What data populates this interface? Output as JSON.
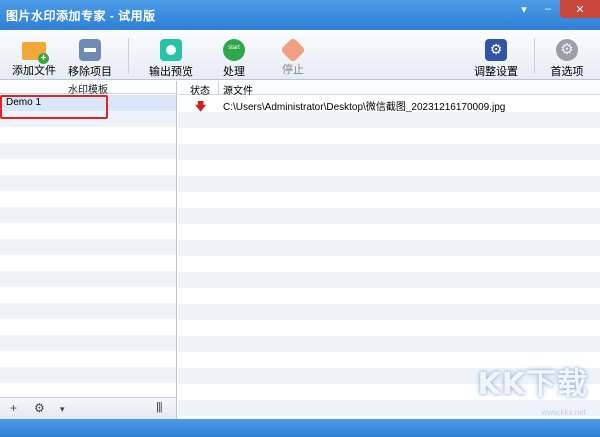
{
  "window": {
    "title": "图片水印添加专家 - 试用版",
    "controls": {
      "minimize": "▾",
      "min2": "–",
      "close": "✕"
    }
  },
  "toolbar": {
    "add_file": "添加文件",
    "remove_item": "移除项目",
    "export_preview": "输出预览",
    "process": "处理",
    "stop": "停止",
    "adjust_settings": "调整设置",
    "preferences": "首选项"
  },
  "left": {
    "header": "水印模板",
    "items": [
      {
        "label": "Demo 1"
      }
    ],
    "footer": {
      "add": "+",
      "settings": "⚙",
      "dropdown": "▾",
      "columns": "|||"
    }
  },
  "right": {
    "columns": {
      "status": "状态",
      "source": "源文件"
    },
    "rows": [
      {
        "status_icon": "arrow-down-icon",
        "path": "C:\\Users\\Administrator\\Desktop\\微信截图_20231216170009.jpg"
      }
    ]
  },
  "watermark": {
    "text": "KK下载",
    "url": "www.kkx.net"
  },
  "colors": {
    "titlebar": "#2f7fd6",
    "highlight": "#e02424",
    "row_alt": "#eef3fa"
  }
}
